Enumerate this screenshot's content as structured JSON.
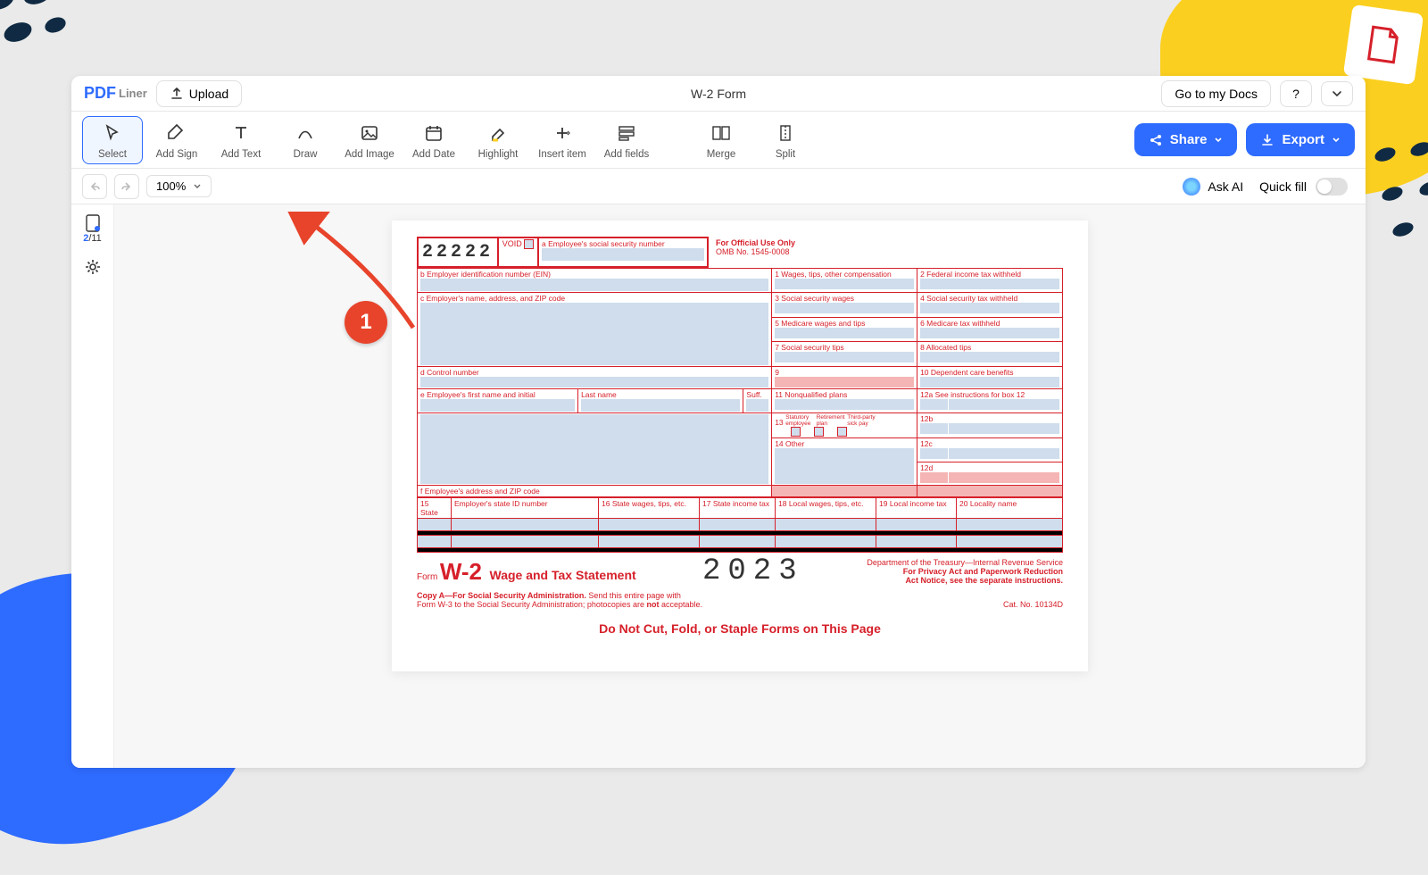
{
  "header": {
    "logo_main": "PDF",
    "logo_sub": "Liner",
    "upload": "Upload",
    "doc_title": "W-2 Form",
    "go_to_docs": "Go to my Docs",
    "help": "?"
  },
  "toolbar": {
    "items": [
      {
        "label": "Select"
      },
      {
        "label": "Add Sign"
      },
      {
        "label": "Add Text"
      },
      {
        "label": "Draw"
      },
      {
        "label": "Add Image"
      },
      {
        "label": "Add Date"
      },
      {
        "label": "Highlight"
      },
      {
        "label": "Insert item"
      },
      {
        "label": "Add fields"
      }
    ],
    "merge": "Merge",
    "split": "Split",
    "share": "Share",
    "export": "Export"
  },
  "subbar": {
    "zoom": "100%",
    "ask_ai": "Ask AI",
    "quick_fill": "Quick fill"
  },
  "sidebar": {
    "page_current": "2",
    "page_sep": "/",
    "page_total": "11"
  },
  "annotation": {
    "badge": "1"
  },
  "w2": {
    "box_number": "22222",
    "void": "VOID",
    "a": "a  Employee's social security number",
    "official": "For Official Use Only",
    "omb": "OMB No. 1545-0008",
    "b": "b  Employer identification number (EIN)",
    "c": "c  Employer's name, address, and ZIP code",
    "d": "d  Control number",
    "e": "e  Employee's first name and initial",
    "lastname": "Last name",
    "suff": "Suff.",
    "f": "f  Employee's address and ZIP code",
    "1": "1   Wages, tips, other compensation",
    "2": "2   Federal income tax withheld",
    "3": "3   Social security wages",
    "4": "4   Social security tax withheld",
    "5": "5   Medicare wages and tips",
    "6": "6   Medicare tax withheld",
    "7": "7   Social security tips",
    "8": "8   Allocated tips",
    "9": "9",
    "10": "10  Dependent care benefits",
    "11": "11  Nonqualified plans",
    "12a": "12a  See instructions for box 12",
    "12b": "12b",
    "12c": "12c",
    "12d": "12d",
    "13": "13",
    "13a": "Statutory employee",
    "13b": "Retirement plan",
    "13c": "Third-party sick pay",
    "14": "14  Other",
    "15": "15  State",
    "15b": "Employer's state ID number",
    "16": "16  State wages, tips, etc.",
    "17": "17  State income tax",
    "18": "18  Local wages, tips, etc.",
    "19": "19  Local income tax",
    "20": "20  Locality name",
    "form_label": "Form",
    "form_code": "W-2",
    "form_name": "Wage and Tax Statement",
    "year": "2023",
    "dept": "Department of the Treasury—Internal Revenue Service",
    "privacy1": "For Privacy Act and Paperwork Reduction",
    "privacy2": "Act Notice, see the separate instructions.",
    "copy_a": "Copy A—For Social Security Administration.",
    "copy_a2": " Send this entire page with",
    "copy_a3": "Form W-3 to the Social Security Administration; photocopies are ",
    "copy_a3b": "not",
    "copy_a3c": " acceptable.",
    "catno": "Cat. No. 10134D",
    "dncut": "Do Not Cut, Fold, or Staple Forms on This Page"
  }
}
